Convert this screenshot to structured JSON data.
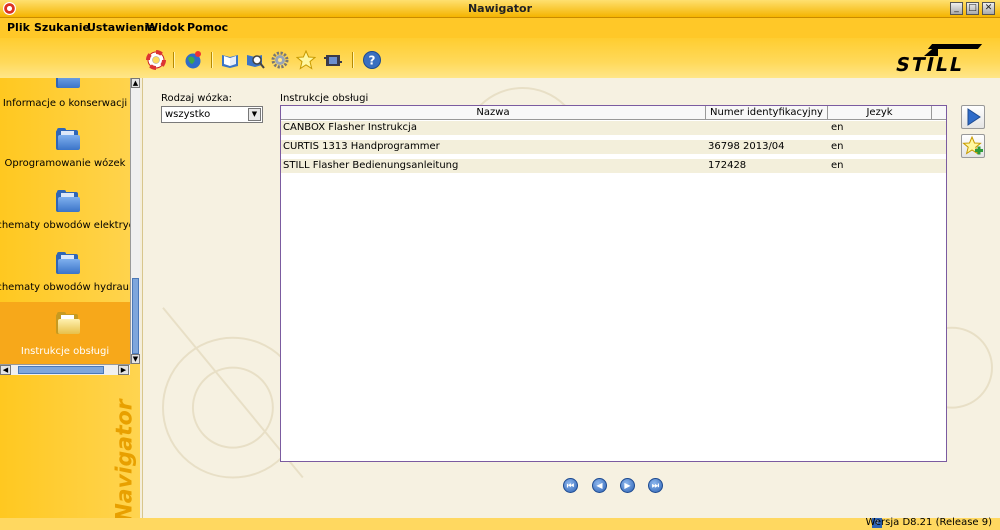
{
  "window": {
    "title": "Nawigator",
    "controls": [
      "minimize",
      "restore",
      "close"
    ]
  },
  "menu": [
    "Plik",
    "Szukanie",
    "Ustawienia",
    "Widok",
    "Pomoc"
  ],
  "toolbar": {
    "icons": [
      "lifebuoy-icon",
      "globe-icon",
      "open-book-icon",
      "search-book-icon",
      "settings-gear-icon",
      "star-icon",
      "film-icon",
      "help-icon"
    ]
  },
  "brand": {
    "logo_text": "STILL",
    "vertical_text": "Navigator"
  },
  "sidebar": {
    "items": [
      {
        "label": "Informacje o konserwacji",
        "active": false
      },
      {
        "label": "Oprogramowanie wózek",
        "active": false
      },
      {
        "label": "Schematy obwodów elektrycznych",
        "active": false
      },
      {
        "label": "Schematy obwodów hydraulicznych",
        "active": false
      },
      {
        "label": "Instrukcje obsługi",
        "active": true
      }
    ]
  },
  "filter": {
    "label": "Rodzaj wózka:",
    "value": "wszystko"
  },
  "table": {
    "title": "Instrukcje obsługi",
    "columns": [
      "Nazwa",
      "Numer identyfikacyjny",
      "Jezyk"
    ],
    "rows": [
      [
        "CANBOX Flasher Instrukcja",
        "",
        "en"
      ],
      [
        "CURTIS 1313 Handprogrammer",
        "36798  2013/04",
        "en"
      ],
      [
        "STILL Flasher Bedienungsanleitung",
        "172428",
        "en"
      ]
    ]
  },
  "side_buttons": [
    "play-arrow-icon",
    "add-favorite-icon"
  ],
  "pager": [
    "first-page-button",
    "previous-page-button",
    "next-page-button",
    "last-page-button"
  ],
  "status": {
    "version": "Wersja D8.21 (Release 9)"
  },
  "colors": {
    "accent": "#ffc828",
    "active_item": "#f7a81a",
    "table_border": "#7b5ba0",
    "pager_blue": "#2c62b4"
  }
}
